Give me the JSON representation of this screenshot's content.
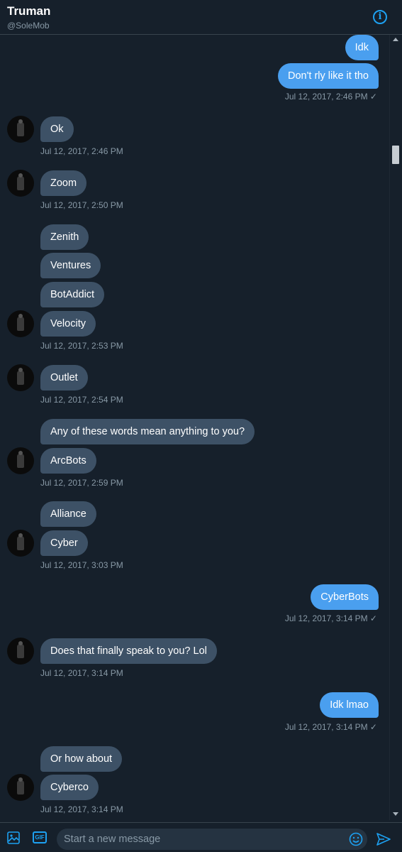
{
  "header": {
    "name": "Truman",
    "handle": "@SoleMob",
    "info_glyph": "i"
  },
  "messages": [
    {
      "text": "Idk",
      "dir": "out"
    },
    {
      "text": "Don't rly like it tho",
      "dir": "out"
    },
    {
      "time": "Jul 12, 2017, 2:46 PM ✓",
      "dir": "out"
    },
    {
      "text": "Ok",
      "dir": "in"
    },
    {
      "time": "Jul 12, 2017, 2:46 PM",
      "dir": "in"
    },
    {
      "text": "Zoom",
      "dir": "in"
    },
    {
      "time": "Jul 12, 2017, 2:50 PM",
      "dir": "in"
    },
    {
      "text": "Zenith",
      "dir": "in"
    },
    {
      "text": "Ventures",
      "dir": "in"
    },
    {
      "text": "BotAddict",
      "dir": "in"
    },
    {
      "text": "Velocity",
      "dir": "in"
    },
    {
      "time": "Jul 12, 2017, 2:53 PM",
      "dir": "in"
    },
    {
      "text": "Outlet",
      "dir": "in"
    },
    {
      "time": "Jul 12, 2017, 2:54 PM",
      "dir": "in"
    },
    {
      "text": "Any of these words mean anything to you?",
      "dir": "in"
    },
    {
      "text": "ArcBots",
      "dir": "in"
    },
    {
      "time": "Jul 12, 2017, 2:59 PM",
      "dir": "in"
    },
    {
      "text": "Alliance",
      "dir": "in"
    },
    {
      "text": "Cyber",
      "dir": "in"
    },
    {
      "time": "Jul 12, 2017, 3:03 PM",
      "dir": "in"
    },
    {
      "text": "CyberBots",
      "dir": "out"
    },
    {
      "time": "Jul 12, 2017, 3:14 PM ✓",
      "dir": "out"
    },
    {
      "text": "Does that finally speak to you? Lol",
      "dir": "in"
    },
    {
      "time": "Jul 12, 2017, 3:14 PM",
      "dir": "in"
    },
    {
      "text": "Idk lmao",
      "dir": "out"
    },
    {
      "time": "Jul 12, 2017, 3:14 PM ✓",
      "dir": "out"
    },
    {
      "text": "Or how about",
      "dir": "in"
    },
    {
      "text": "Cyberco",
      "dir": "in"
    },
    {
      "time": "Jul 12, 2017, 3:14 PM",
      "dir": "in"
    }
  ],
  "composer": {
    "placeholder": "Start a new message",
    "gif_label": "GIF"
  },
  "colors": {
    "background": "#16202b",
    "incoming_bubble": "#3d5166",
    "outgoing_bubble": "#4a9fef",
    "accent": "#1da1f2",
    "muted_text": "#8899a6"
  },
  "icons": {
    "info": "info-circle-icon",
    "media": "image-icon",
    "gif": "gif-icon",
    "emoji": "smiley-icon",
    "send": "send-arrow-icon",
    "avatar": "user-avatar"
  }
}
